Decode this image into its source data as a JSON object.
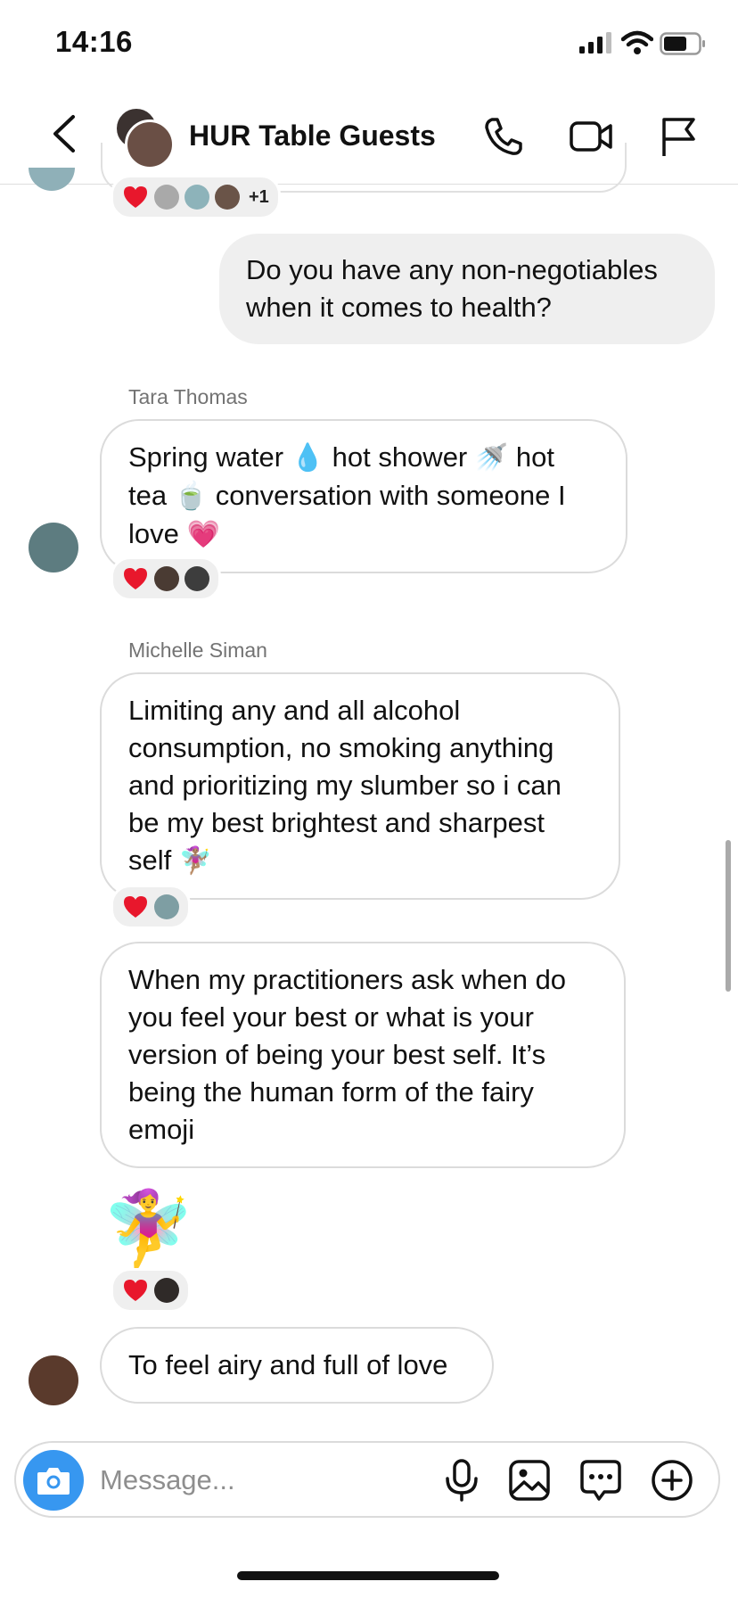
{
  "status_bar": {
    "time": "14:16"
  },
  "header": {
    "title": "HUR Table Guests"
  },
  "reactions": {
    "r1_more": "+1"
  },
  "messages": [
    {
      "side": "out",
      "text": "Do you have any non-negotiables when it comes to health?"
    },
    {
      "side": "in",
      "sender": "Tara Thomas",
      "parts": [
        "Spring water ",
        "💧",
        " hot shower ",
        "🚿",
        " hot tea ",
        "🍵",
        " conversation with someone I love ",
        "💗"
      ]
    },
    {
      "side": "in",
      "sender": "Michelle Siman",
      "text": "Limiting any and all alcohol consumption, no smoking anything and prioritizing my slumber so i can be my best brightest and sharpest self",
      "emoji": "🧚🏽‍♀️"
    },
    {
      "side": "in",
      "text": "When my practitioners ask when do you feel your best or what is your version of being your best self. It’s being the human form of the fairy emoji"
    },
    {
      "side": "in",
      "sticker": "🧚‍♀️"
    },
    {
      "side": "in",
      "text": "To feel airy and full of love"
    }
  ],
  "composer": {
    "placeholder": "Message..."
  },
  "colors": {
    "accent": "#3797f0",
    "outgoing_bubble": "#efefef",
    "bubble_border": "#dbdbdb"
  },
  "icons": [
    "back-icon",
    "phone-icon",
    "video-icon",
    "flag-icon",
    "camera-icon",
    "mic-icon",
    "gallery-icon",
    "sticker-icon",
    "plus-icon",
    "heart-icon"
  ]
}
